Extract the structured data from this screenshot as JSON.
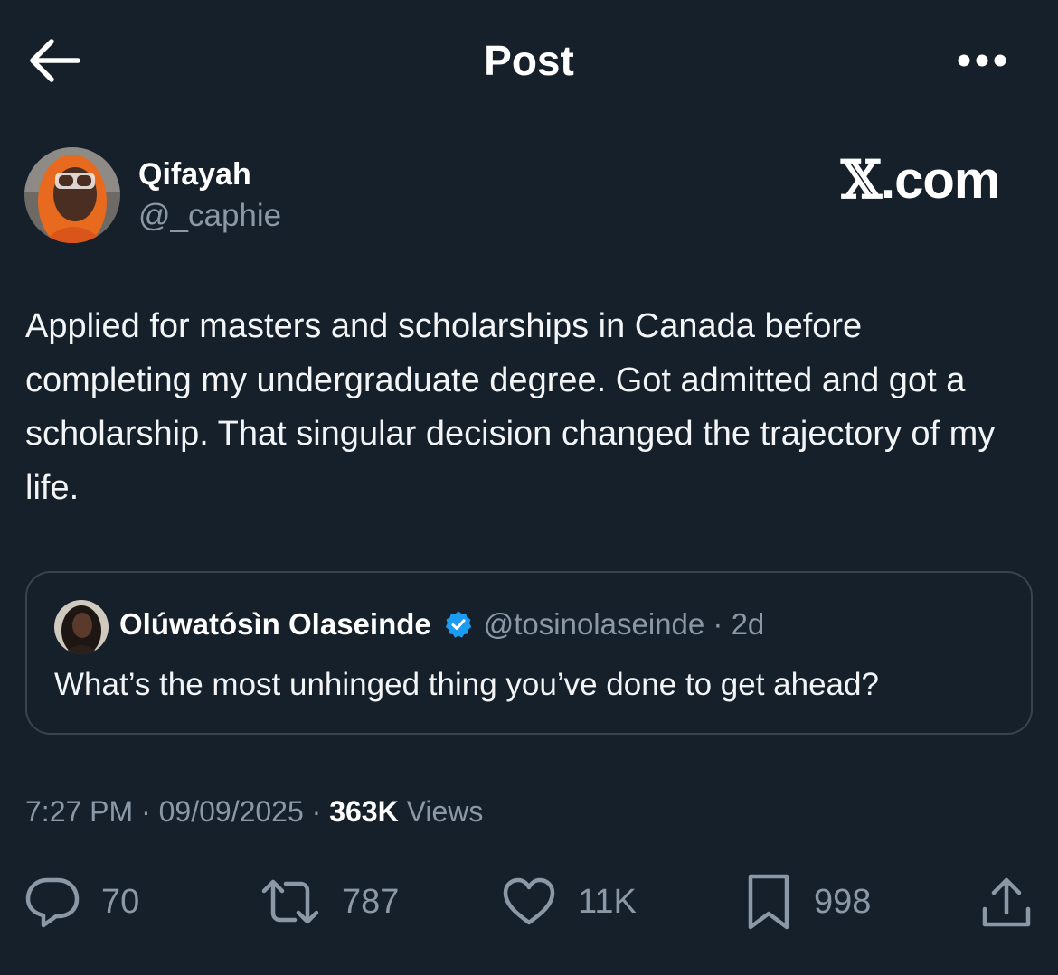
{
  "header": {
    "title": "Post",
    "back_icon": "arrow-left-icon",
    "more_icon": "more-horizontal-icon"
  },
  "post": {
    "author_name": "Qifayah",
    "author_handle": "@_caphie",
    "watermark_x": "𝕏",
    "watermark_domain": ".com",
    "text": "Applied for masters and scholarships in Canada before completing my undergraduate degree. Got admitted and got a scholarship. That singular decision changed the trajectory of my life.",
    "time": "7:27 PM",
    "date": "09/09/2025",
    "views_count": "363K",
    "views_label": "Views",
    "separator": "·"
  },
  "quote": {
    "author_name": "Olúwatósìn Olaseinde",
    "handle_and_age": "@tosinolaseinde · 2d",
    "text": "What’s the most unhinged thing you’ve done to get ahead?",
    "verified_icon": "verified-badge-icon"
  },
  "actions": {
    "replies": "70",
    "reposts": "787",
    "likes": "11K",
    "bookmarks": "998"
  },
  "colors": {
    "background": "#15202b",
    "secondary_text": "#8b98a5",
    "border": "#38444d",
    "verified": "#1d9bf0"
  }
}
